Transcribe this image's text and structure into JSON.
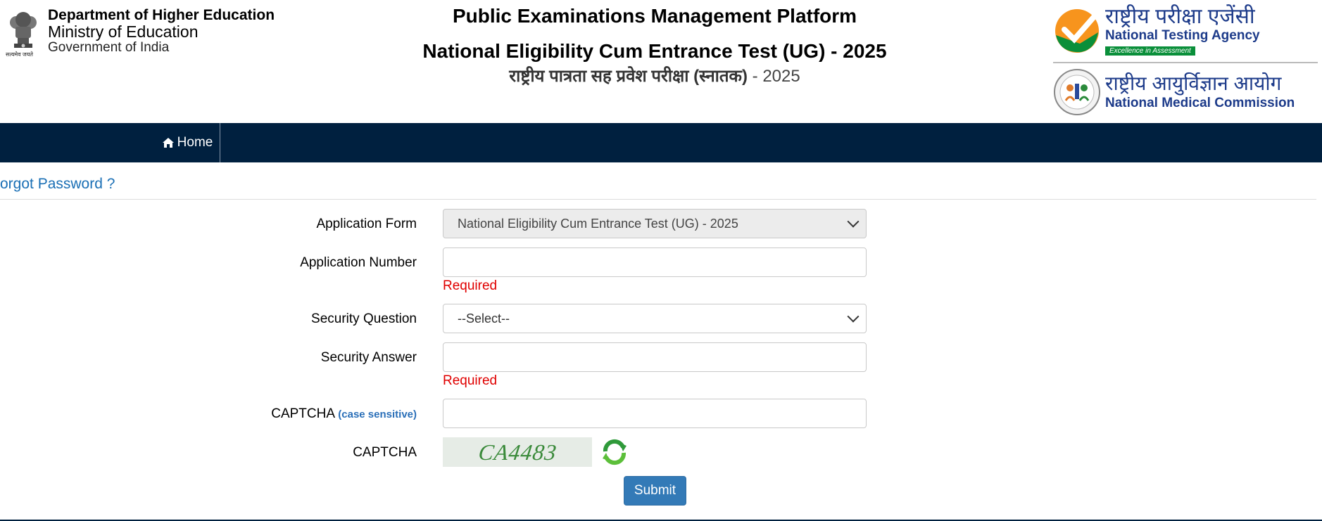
{
  "header": {
    "department": "Department of Higher Education",
    "ministry": "Ministry of Education",
    "government": "Government of India",
    "emblem_caption": "सत्यमेव जयते",
    "title_line1": "Public Examinations Management Platform",
    "title_line2": "National Eligibility Cum Entrance Test (UG) - 2025",
    "title_hindi_main": "राष्ट्रीय पात्रता सह प्रवेश परीक्षा (स्नातक)",
    "title_hindi_year": " - 2025",
    "nta_hindi": "राष्ट्रीय परीक्षा एजेंसी",
    "nta_english": "National Testing Agency",
    "nta_tagline": "Excellence in Assessment",
    "nmc_hindi": "राष्ट्रीय आयुर्विज्ञान आयोग",
    "nmc_english": "National Medical Commission"
  },
  "nav": {
    "home_label": "Home"
  },
  "page": {
    "heading": "orgot Password ?"
  },
  "form": {
    "application_form_label": "Application Form",
    "application_form_value": "National Eligibility Cum Entrance Test (UG) - 2025",
    "application_number_label": "Application Number",
    "application_number_value": "",
    "security_question_label": "Security Question",
    "security_question_value": "--Select--",
    "security_answer_label": "Security Answer",
    "security_answer_value": "",
    "captcha_input_label": "CAPTCHA",
    "captcha_case_note": "(case sensitive)",
    "captcha_input_value": "",
    "captcha_label": "CAPTCHA",
    "captcha_text": "CA4483",
    "required_text": "Required",
    "submit_label": "Submit"
  },
  "colors": {
    "nav_bg": "#00203f",
    "heading_blue": "#1a6fb5",
    "required_red": "#e00000",
    "button_blue": "#337ab7"
  }
}
